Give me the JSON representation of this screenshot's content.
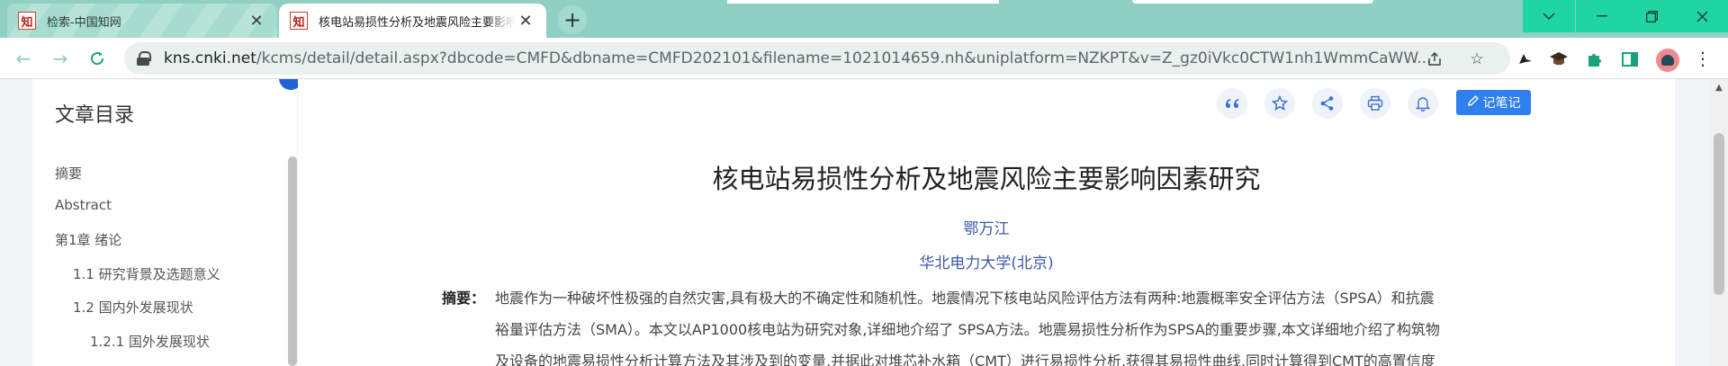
{
  "browser": {
    "tabs": [
      {
        "title": "检索-中国知网",
        "favicon": "知",
        "active": false
      },
      {
        "title": "核电站易损性分析及地震风险主要影响因素研究",
        "favicon": "知",
        "active": true
      }
    ],
    "new_tab_icon": "plus-icon",
    "url_host": "kns.cnki.net",
    "url_path": "/kcms/detail/detail.aspx?dbcode=CMFD&dbname=CMFD202101&filename=1021014659.nh&uniplatform=NZKPT&v=Z_gz0iVkc0CTW1nh1WmmCaWW...",
    "accent_color": "#1fd6a2"
  },
  "sidebar": {
    "title": "文章目录",
    "items": [
      {
        "label": "摘要",
        "level": 1
      },
      {
        "label": "Abstract",
        "level": 1
      },
      {
        "label": "第1章 绪论",
        "level": 1
      },
      {
        "label": "1.1 研究背景及选题意义",
        "level": 2
      },
      {
        "label": "1.2 国内外发展现状",
        "level": 2
      },
      {
        "label": "1.2.1 国外发展现状",
        "level": 3
      }
    ]
  },
  "article": {
    "actions": [
      "quote-icon",
      "star-icon",
      "share-icon",
      "print-icon",
      "bell-icon"
    ],
    "note_button": "记笔记",
    "title": "核电站易损性分析及地震风险主要影响因素研究",
    "author": "鄂万江",
    "affiliation": "华北电力大学(北京)",
    "abstract_label": "摘要：",
    "abstract_lines": [
      "地震作为一种破坏性极强的自然灾害,具有极大的不确定性和随机性。地震情况下核电站风险评估方法有两种:地震概率安全评估方法（SPSA）和抗震",
      "裕量评估方法（SMA）。本文以AP1000核电站为研究对象,详细地介绍了 SPSA方法。地震易损性分析作为SPSA的重要步骤,本文详细地介绍了构筑物",
      "及设备的地震易损性分析计算方法及其涉及到的变量,并据此对堆芯补水箱（CMT）进行易损性分析,获得其易损性曲线,同时计算得到CMT的高置信度"
    ]
  }
}
